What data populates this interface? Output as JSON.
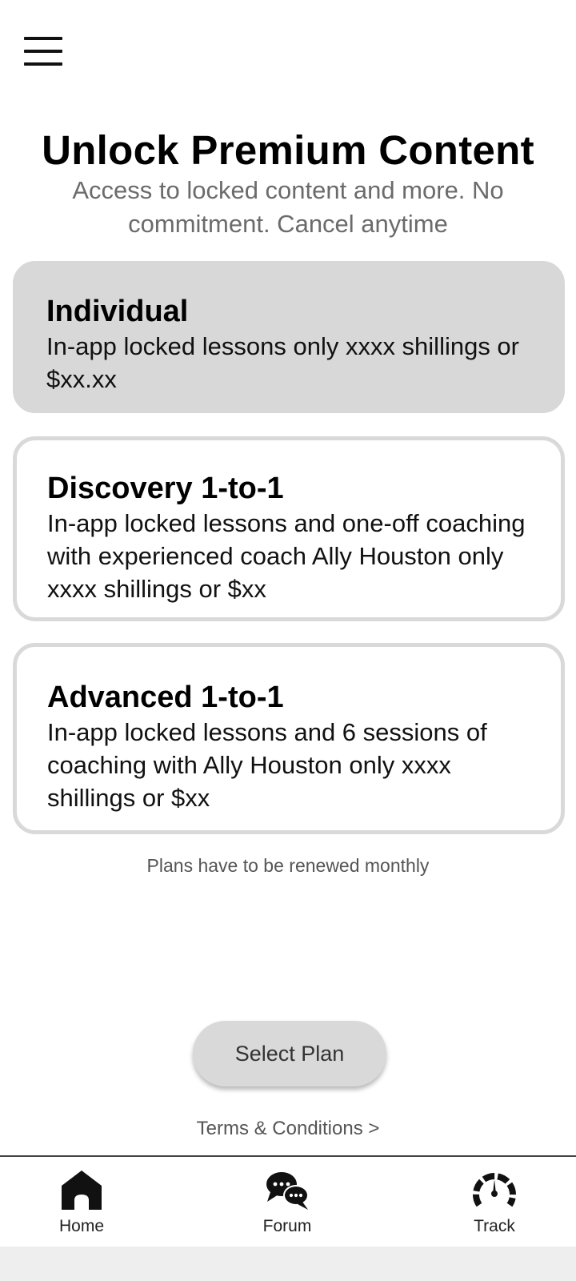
{
  "header": {
    "title": "Unlock Premium Content",
    "subtitle": "Access to locked content and more. No commitment. Cancel anytime"
  },
  "plans": [
    {
      "name": "Individual",
      "description": "In-app locked lessons only xxxx shillings or $xx.xx",
      "selected": true
    },
    {
      "name": "Discovery 1-to-1",
      "description": "In-app locked lessons and one-off coaching with experienced coach Ally Houston only xxxx shillings or $xx",
      "selected": false
    },
    {
      "name": "Advanced 1-to-1",
      "description": "In-app locked lessons and 6 sessions of coaching with Ally Houston only xxxx shillings or $xx",
      "selected": false
    }
  ],
  "renew_note": "Plans have to be renewed monthly",
  "select_button_label": "Select Plan",
  "terms_link": "Terms & Conditions >",
  "nav": {
    "home": {
      "label": "Home",
      "icon": "home-icon"
    },
    "forum": {
      "label": "Forum",
      "icon": "chat-bubbles-icon"
    },
    "track": {
      "label": "Track",
      "icon": "speedometer-icon"
    }
  },
  "colors": {
    "selected_card": "#d8d8d8",
    "card_border": "#d9d9d9",
    "button": "#d9d9d9",
    "muted_text": "#6b6b6b"
  }
}
